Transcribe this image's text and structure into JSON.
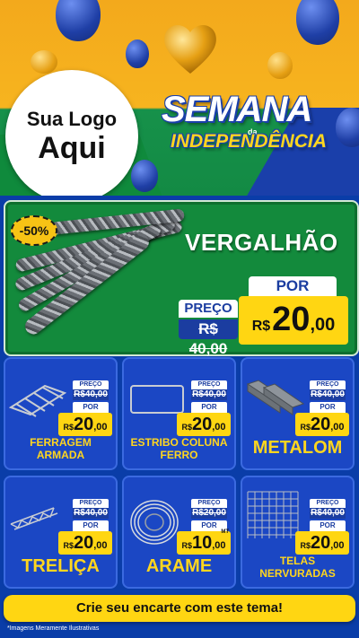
{
  "header": {
    "logo_line1": "Sua Logo",
    "logo_line2": "Aqui",
    "campaign_title": "SEMANA",
    "campaign_small": "da",
    "campaign_subtitle": "INDEPENDÊNCIA"
  },
  "featured": {
    "discount_badge": "-50%",
    "title": "VERGALHÃO",
    "preco_label": "PREÇO",
    "old_price": "R$ 40,00",
    "por_label": "POR",
    "currency": "R$",
    "price_int": "20",
    "price_dec": ",00"
  },
  "products": [
    {
      "name": "FERRAGEM ARMADA",
      "preco_label": "PREÇO",
      "old_price": "R$40,00",
      "por_label": "POR",
      "currency": "R$",
      "price_int": "20",
      "price_dec": ",00"
    },
    {
      "name": "ESTRIBO COLUNA FERRO",
      "preco_label": "PREÇO",
      "old_price": "R$40,00",
      "por_label": "POR",
      "currency": "R$",
      "price_int": "20",
      "price_dec": ",00"
    },
    {
      "name": "METALOM",
      "preco_label": "PREÇO",
      "old_price": "R$40,00",
      "por_label": "POR",
      "currency": "R$",
      "price_int": "20",
      "price_dec": ",00"
    },
    {
      "name": "TRELIÇA",
      "preco_label": "PREÇO",
      "old_price": "R$40,00",
      "por_label": "POR",
      "currency": "R$",
      "price_int": "20",
      "price_dec": ",00"
    },
    {
      "name": "ARAME",
      "preco_label": "PREÇO",
      "old_price": "R$20,00",
      "por_label": "POR",
      "currency": "R$",
      "price_int": "10",
      "price_dec": ",00",
      "unit": "MT"
    },
    {
      "name": "TELAS NERVURADAS",
      "preco_label": "PREÇO",
      "old_price": "R$40,00",
      "por_label": "POR",
      "currency": "R$",
      "price_int": "20",
      "price_dec": ",00"
    }
  ],
  "footer": {
    "cta": "Crie seu encarte com este tema!",
    "disclaimer": "*Imagens Meramente Ilustrativas"
  },
  "colors": {
    "blue": "#1b47c4",
    "green": "#138a3c",
    "yellow": "#ffd612",
    "orange": "#f3a91c"
  }
}
